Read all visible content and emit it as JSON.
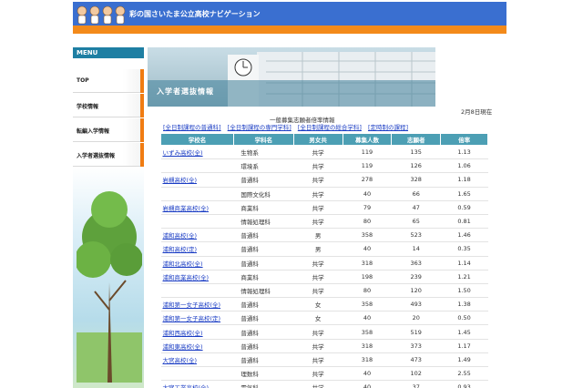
{
  "header": {
    "title": "彩の国さいたま公立高校ナビゲーション",
    "brand_color": "#3a6fd0",
    "stripe_color": "#f38a1a"
  },
  "sidebar": {
    "menu_label": "MENU",
    "items": [
      {
        "label": "TOP"
      },
      {
        "label": "学校情報"
      },
      {
        "label": "転編入学情報"
      },
      {
        "label": "入学者選抜情報"
      }
    ]
  },
  "banner": {
    "title": "入学者選抜情報"
  },
  "content": {
    "as_of": "2月8日現在",
    "caption": "一般募集志願者倍率情報",
    "course_links": [
      "[全日制課程の普通科]",
      "[全日制課程の専門学科]",
      "[全日制課程の総合学科]",
      "[定時制の課程]"
    ],
    "columns": [
      "学校名",
      "学科名",
      "男女共",
      "募集人数",
      "志願者",
      "倍率"
    ],
    "rows": [
      {
        "school": "いずみ高校(全)",
        "course": "生物系",
        "gender": "共学",
        "quota": "119",
        "applicants": "135",
        "ratio": "1.13"
      },
      {
        "school": "",
        "course": "環境系",
        "gender": "共学",
        "quota": "119",
        "applicants": "126",
        "ratio": "1.06"
      },
      {
        "school": "岩槻高校(全)",
        "course": "普通科",
        "gender": "共学",
        "quota": "278",
        "applicants": "328",
        "ratio": "1.18"
      },
      {
        "school": "",
        "course": "国際文化科",
        "gender": "共学",
        "quota": "40",
        "applicants": "66",
        "ratio": "1.65"
      },
      {
        "school": "岩槻商業高校(全)",
        "course": "商業科",
        "gender": "共学",
        "quota": "79",
        "applicants": "47",
        "ratio": "0.59"
      },
      {
        "school": "",
        "course": "情報処理科",
        "gender": "共学",
        "quota": "80",
        "applicants": "65",
        "ratio": "0.81"
      },
      {
        "school": "浦和高校(全)",
        "course": "普通科",
        "gender": "男",
        "quota": "358",
        "applicants": "523",
        "ratio": "1.46"
      },
      {
        "school": "浦和高校(定)",
        "course": "普通科",
        "gender": "男",
        "quota": "40",
        "applicants": "14",
        "ratio": "0.35"
      },
      {
        "school": "浦和北高校(全)",
        "course": "普通科",
        "gender": "共学",
        "quota": "318",
        "applicants": "363",
        "ratio": "1.14"
      },
      {
        "school": "浦和商業高校(全)",
        "course": "商業科",
        "gender": "共学",
        "quota": "198",
        "applicants": "239",
        "ratio": "1.21"
      },
      {
        "school": "",
        "course": "情報処理科",
        "gender": "共学",
        "quota": "80",
        "applicants": "120",
        "ratio": "1.50"
      },
      {
        "school": "浦和第一女子高校(全)",
        "course": "普通科",
        "gender": "女",
        "quota": "358",
        "applicants": "493",
        "ratio": "1.38"
      },
      {
        "school": "浦和第一女子高校(定)",
        "course": "普通科",
        "gender": "女",
        "quota": "40",
        "applicants": "20",
        "ratio": "0.50"
      },
      {
        "school": "浦和西高校(全)",
        "course": "普通科",
        "gender": "共学",
        "quota": "358",
        "applicants": "519",
        "ratio": "1.45"
      },
      {
        "school": "浦和東高校(全)",
        "course": "普通科",
        "gender": "共学",
        "quota": "318",
        "applicants": "373",
        "ratio": "1.17"
      },
      {
        "school": "大宮高校(全)",
        "course": "普通科",
        "gender": "共学",
        "quota": "318",
        "applicants": "473",
        "ratio": "1.49"
      },
      {
        "school": "",
        "course": "理数科",
        "gender": "共学",
        "quota": "40",
        "applicants": "102",
        "ratio": "2.55"
      },
      {
        "school": "大宮工業高校(全)",
        "course": "電気科",
        "gender": "共学",
        "quota": "40",
        "applicants": "37",
        "ratio": "0.93"
      }
    ]
  }
}
